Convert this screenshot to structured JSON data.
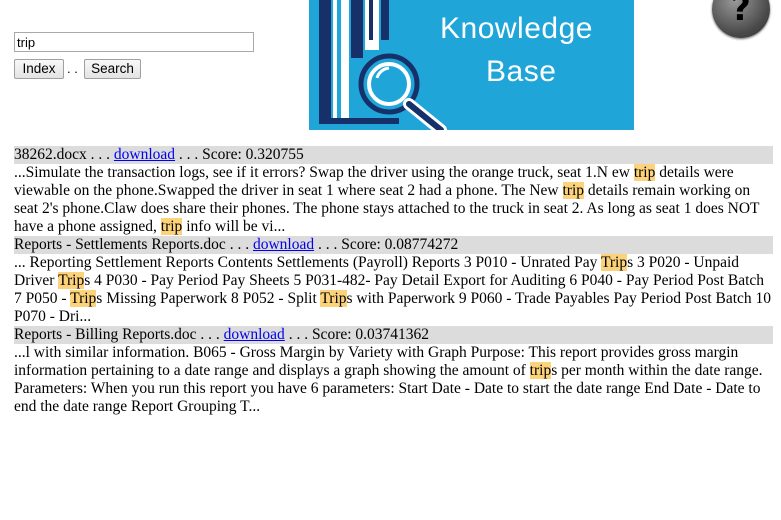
{
  "search": {
    "value": "trip"
  },
  "buttons": {
    "index": "Index",
    "separator": ". .",
    "search": "Search"
  },
  "logo": {
    "line1": "Knowledge",
    "line2": "Base",
    "icon": "books-magnifier-icon"
  },
  "help": {
    "label": "?",
    "icon": "help-icon"
  },
  "colors": {
    "logo_bg": "#1fa5d8",
    "highlight": "#fcd37a",
    "result_header_bg": "#dcdcdc",
    "link": "#0000ee"
  },
  "results": [
    {
      "file": "38262.docx",
      "sep1": " . . . ",
      "link": "download",
      "sep2": " . . . ",
      "score": "Score: 0.320755",
      "snippet": [
        {
          "t": "...Simulate the transaction logs, see if it errors? Swap the driver using the orange truck, seat 1.N ew "
        },
        {
          "h": "trip"
        },
        {
          "t": " details were viewable on the phone.Swapped the driver in seat 1 where seat 2 had a phone. The New "
        },
        {
          "h": "trip"
        },
        {
          "t": " details remain working on seat 2's phone.Claw does share their phones. The phone stays attached to the truck in seat 2. As long as seat 1 does NOT have a phone assigned, "
        },
        {
          "h": "trip"
        },
        {
          "t": " info will be vi..."
        }
      ]
    },
    {
      "file": "Reports - Settlements Reports.doc",
      "sep1": " . . . ",
      "link": "download",
      "sep2": " . . . ",
      "score": "Score: 0.08774272",
      "snippet": [
        {
          "t": "... Reporting Settlement Reports Contents Settlements (Payroll) Reports 3 P010 - Unrated Pay "
        },
        {
          "h": "Trip"
        },
        {
          "t": "s 3 P020 - Unpaid Driver "
        },
        {
          "h": "Trip"
        },
        {
          "t": "s 4 P030 - Pay Period Pay Sheets 5 P031-482- Pay Detail Export for Auditing 6 P040 - Pay Period Post Batch 7 P050 - "
        },
        {
          "h": "Trip"
        },
        {
          "t": "s Missing Paperwork 8 P052 - Split "
        },
        {
          "h": "Trip"
        },
        {
          "t": "s with Paperwork 9 P060 - Trade Payables Pay Period Post Batch 10 P070 - Dri..."
        }
      ]
    },
    {
      "file": "Reports - Billing Reports.doc",
      "sep1": " . . . ",
      "link": "download",
      "sep2": " . . . ",
      "score": "Score: 0.03741362",
      "snippet": [
        {
          "t": "...l with similar information. B065 - Gross Margin by Variety with Graph Purpose: This report provides gross margin information pertaining to a date range and displays a graph showing the amount of "
        },
        {
          "h": "trip"
        },
        {
          "t": "s per month within the date range. Parameters: When you run this report you have 6 parameters: Start Date - Date to start the date range End Date - Date to end the date range Report Grouping T..."
        }
      ]
    }
  ]
}
